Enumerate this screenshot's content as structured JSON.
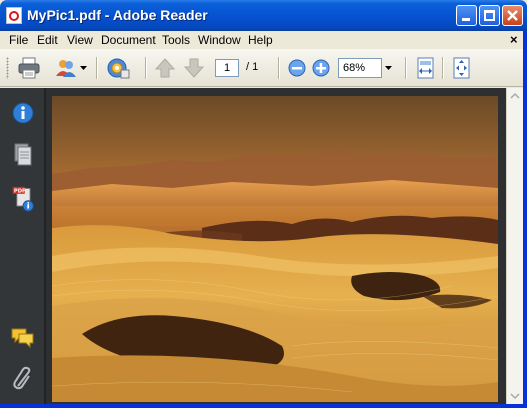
{
  "window": {
    "title": "MyPic1.pdf - Adobe Reader"
  },
  "menu": {
    "items": [
      "File",
      "Edit",
      "View",
      "Document",
      "Tools",
      "Window",
      "Help"
    ],
    "doc_close": "×"
  },
  "toolbar": {
    "current_page": "1",
    "page_total": "/ 1",
    "zoom": "68%"
  },
  "icons": {
    "toolbar": [
      "printer-icon",
      "email-share-icon",
      "settings-gear-icon",
      "previous-page-icon",
      "next-page-icon",
      "zoom-out-icon",
      "zoom-in-icon",
      "fit-width-icon",
      "fit-page-icon"
    ],
    "leftnav": [
      "info-icon",
      "pages-icon",
      "pdf-properties-icon",
      "comments-icon",
      "attachment-icon"
    ]
  },
  "document": {
    "content": "desert sand dunes photograph"
  },
  "colors": {
    "titlebar": "#0653d1",
    "leftnav": "#333638",
    "doc_background": "#2d2f31"
  }
}
